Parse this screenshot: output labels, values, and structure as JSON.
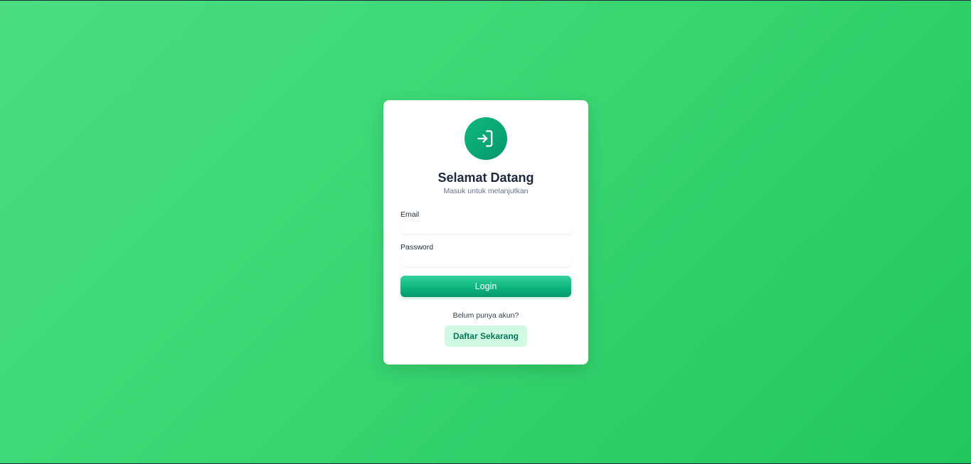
{
  "login_card": {
    "icon": "login-arrow-icon",
    "title": "Selamat Datang",
    "subtitle": "Masuk untuk melanjutkan",
    "email": {
      "label": "Email",
      "value": "",
      "placeholder": ""
    },
    "password": {
      "label": "Password",
      "value": "",
      "placeholder": ""
    },
    "login_label": "Login",
    "register_prompt": "Belum punya akun?",
    "register_label": "Daftar Sekarang"
  },
  "colors": {
    "background_start": "#4ade80",
    "background_end": "#22c55e",
    "accent": "#10b981",
    "accent_dark": "#059669",
    "register_bg": "#d1fae5",
    "register_text": "#047857",
    "title_text": "#1e293b"
  }
}
